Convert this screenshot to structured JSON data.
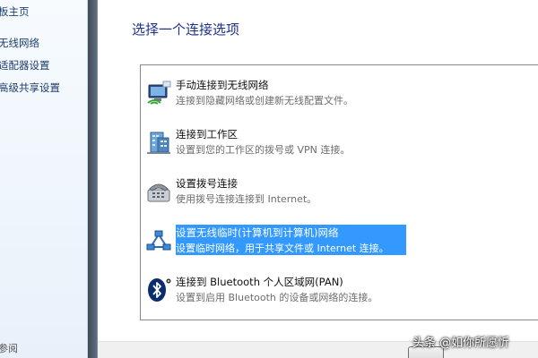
{
  "sidebar": {
    "items": [
      {
        "label": "板主页"
      },
      {
        "label": "无线网络"
      },
      {
        "label": "适配器设置"
      },
      {
        "label": "高级共享设置"
      }
    ],
    "bottom": "参阅"
  },
  "dialog": {
    "title": "选择一个连接选项",
    "options": [
      {
        "title": "手动连接到无线网络",
        "desc": "连接到隐藏网络或创建新无线配置文件。",
        "icon": "wireless-network-icon"
      },
      {
        "title": "连接到工作区",
        "desc": "设置到您的工作区的拨号或 VPN 连接。",
        "icon": "workplace-building-icon"
      },
      {
        "title": "设置拨号连接",
        "desc": "使用拨号连接连接到 Internet。",
        "icon": "dialup-telephone-icon"
      },
      {
        "title": "设置无线临时(计算机到计算机)网络",
        "desc": "设置临时网络，用于共享文件或 Internet 连接。",
        "icon": "adhoc-network-icon",
        "selected": true
      },
      {
        "title": "连接到 Bluetooth 个人区域网(PAN)",
        "desc": "设置到启用 Bluetooth 的设备或网络的连接。",
        "icon": "bluetooth-icon"
      }
    ]
  },
  "watermark": "头条 @如你所愿忻",
  "colors": {
    "selection": "#3399ff",
    "title": "#1e3287",
    "link": "#1e3d6f"
  }
}
